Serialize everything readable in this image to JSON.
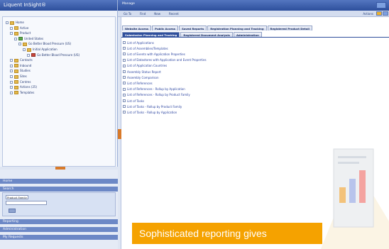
{
  "app": {
    "title": "Liquent InSight®"
  },
  "header": {
    "crumb": "Manage"
  },
  "menu": {
    "items": [
      "Go To",
      "Find",
      "New",
      "Recent"
    ],
    "actions": "Actions"
  },
  "tree": [
    {
      "label": "Home",
      "indent": 0,
      "kind": "folder"
    },
    {
      "label": "Active",
      "indent": 1,
      "kind": "folder"
    },
    {
      "label": "Product",
      "indent": 1,
      "kind": "folder"
    },
    {
      "label": "United States",
      "indent": 2,
      "kind": "green"
    },
    {
      "label": "Go Better Blood Pressure (US)",
      "indent": 3,
      "kind": "folder"
    },
    {
      "label": "Initial Application",
      "indent": 4,
      "kind": "folder"
    },
    {
      "label": "Go Better Blood Pressure (US)",
      "indent": 5,
      "kind": "red"
    },
    {
      "label": "Contacts",
      "indent": 1,
      "kind": "folder"
    },
    {
      "label": "Inbound",
      "indent": 1,
      "kind": "folder"
    },
    {
      "label": "Studies",
      "indent": 1,
      "kind": "folder"
    },
    {
      "label": "Sites",
      "indent": 1,
      "kind": "folder"
    },
    {
      "label": "Centres",
      "indent": 1,
      "kind": "folder"
    },
    {
      "label": "Actions (25)",
      "indent": 1,
      "kind": "folder"
    },
    {
      "label": "Templates",
      "indent": 1,
      "kind": "folder"
    }
  ],
  "left_sections": {
    "home": "Home",
    "search": "Search",
    "search_field": "Product Family",
    "reporting": "Reporting",
    "administration": "Administration",
    "my_requests": "My Requests"
  },
  "tabs_row1": [
    "Website Access",
    "Public Access",
    "Saved Reports",
    "Registration Planning and Tracking",
    "Registered Product Detail"
  ],
  "tabs_row2": [
    "Submission Planning and Tracking",
    "Registered Document Analysis",
    "Administration"
  ],
  "active_tab": "Submission Planning and Tracking",
  "reports": [
    "List of Applications",
    "List of Assemblies/Templates",
    "List of Events with Application Properties",
    "List of Datastores with Application and Event Properties",
    "List of Application Countries",
    "Assembly Status Report",
    "Assembly Comparison",
    "List of References",
    "List of References - Rollup by Application",
    "List of References - Rollup by Product Family",
    "List of Tasks",
    "List of Tasks - Rollup by Product Family",
    "List of Tasks - Rollup by Application"
  ],
  "banner": {
    "text": "Sophisticated reporting gives"
  },
  "colors": {
    "brand": "#2d4f9c",
    "banner": "#f5a200",
    "link": "#2b44a0"
  }
}
